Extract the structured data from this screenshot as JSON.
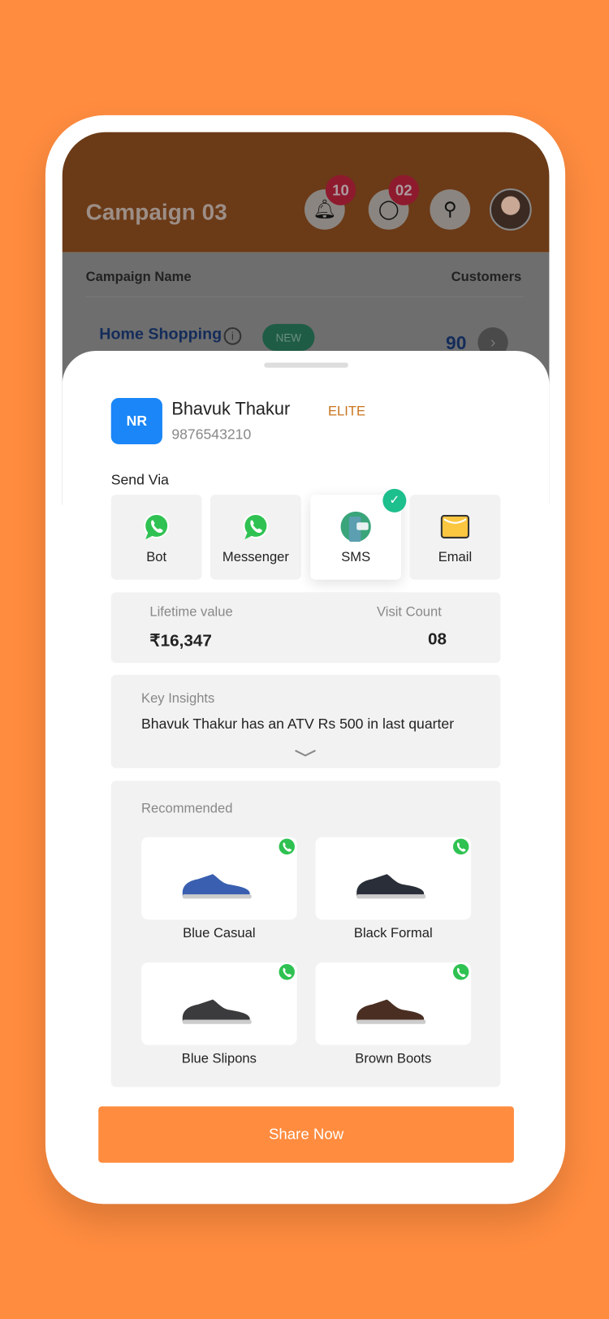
{
  "header": {
    "title": "Campaign 03",
    "notifications_badge": "10",
    "messages_badge": "02"
  },
  "table": {
    "col_name": "Campaign Name",
    "col_customers": "Customers",
    "row": {
      "name": "Home Shopping",
      "badge": "NEW",
      "customers": "90"
    }
  },
  "customer": {
    "initials": "NR",
    "name": "Bhavuk Thakur",
    "tier": "ELITE",
    "phone": "9876543210"
  },
  "send_via": {
    "label": "Send Via",
    "options": [
      {
        "label": "Bot",
        "icon": "whatsapp-icon"
      },
      {
        "label": "Messenger",
        "icon": "whatsapp-icon"
      },
      {
        "label": "SMS",
        "icon": "sms-icon",
        "selected": true
      },
      {
        "label": "Email",
        "icon": "email-icon"
      }
    ]
  },
  "stats": {
    "lifetime_label": "Lifetime value",
    "lifetime_value": "₹16,347",
    "visit_label": "Visit Count",
    "visit_value": "08"
  },
  "insights": {
    "label": "Key Insights",
    "text": "Bhavuk Thakur has an ATV Rs 500 in last quarter"
  },
  "recommended": {
    "label": "Recommended",
    "products": [
      {
        "name": "Blue Casual",
        "color": "#3A5FB0"
      },
      {
        "name": "Black Formal",
        "color": "#2A2E38"
      },
      {
        "name": "Blue Slipons",
        "color": "#3B3B3E"
      },
      {
        "name": "Brown Boots",
        "color": "#4A2E22"
      }
    ]
  },
  "share_label": "Share Now",
  "colors": {
    "accent": "#FF8C3F",
    "avatar_bg": "#1A86F7",
    "elite": "#C9741E",
    "check": "#1DBF8D"
  }
}
